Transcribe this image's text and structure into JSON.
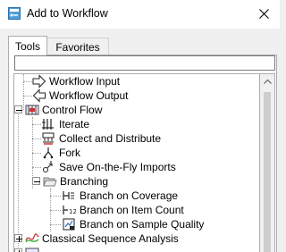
{
  "window": {
    "title": "Add to Workflow",
    "close_icon": "close-icon"
  },
  "tabs": [
    {
      "label": "Tools",
      "selected": true
    },
    {
      "label": "Favorites",
      "selected": false
    }
  ],
  "search": {
    "value": "",
    "placeholder": ""
  },
  "tree": {
    "items": [
      {
        "label": "Workflow Input",
        "icon": "workflow-input-arrow-icon",
        "level": 1
      },
      {
        "label": "Workflow Output",
        "icon": "workflow-output-arrow-icon",
        "level": 1
      },
      {
        "label": "Control Flow",
        "icon": "control-flow-icon",
        "level": 0,
        "expanded": true
      },
      {
        "label": "Iterate",
        "icon": "iterate-icon",
        "level": 1
      },
      {
        "label": "Collect and Distribute",
        "icon": "collect-distribute-icon",
        "level": 1
      },
      {
        "label": "Fork",
        "icon": "fork-icon",
        "level": 1
      },
      {
        "label": "Save On-the-Fly Imports",
        "icon": "save-imports-icon",
        "level": 1
      },
      {
        "label": "Branching",
        "icon": "folder-open-icon",
        "level": 1,
        "expanded": true
      },
      {
        "label": "Branch on Coverage",
        "icon": "branch-coverage-icon",
        "level": 2
      },
      {
        "label": "Branch on Item Count",
        "icon": "branch-item-count-icon",
        "level": 2
      },
      {
        "label": "Branch on Sample Quality",
        "icon": "branch-sample-quality-icon",
        "level": 2
      },
      {
        "label": "Classical Sequence Analysis",
        "icon": "classical-sequence-icon",
        "level": 0,
        "expanded": false
      }
    ]
  },
  "colors": {
    "titlebar": "#ffffff",
    "background": "#f0f0f0",
    "panel_border": "#adadad",
    "scrollbar_thumb": "#cdcdcd"
  }
}
